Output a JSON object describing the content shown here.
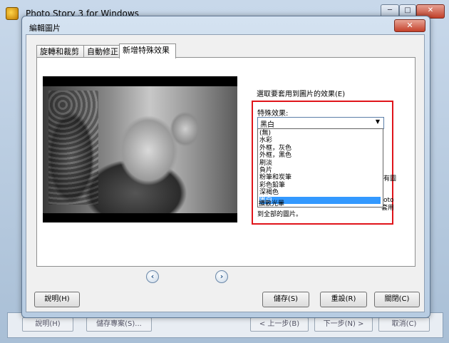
{
  "outer": {
    "title": "Photo Story 3 for Windows",
    "min_label": "─",
    "max_label": "□",
    "close_label": "✕",
    "ghost_buttons": [
      "說明(H)",
      "儲存專案(S)...",
      "< 上一步(B)",
      "下一步(N) >",
      "取消(C)"
    ]
  },
  "dialog": {
    "title": "編輯圖片",
    "close_label": "✕",
    "tabs": [
      "旋轉和裁剪",
      "自動修正",
      "新增特殊效果"
    ],
    "active_tab": 2
  },
  "nav": {
    "prev_label": "‹",
    "next_label": "›"
  },
  "effects": {
    "instruction": "選取要套用到圖片的效果(E)",
    "label": "特殊效果:",
    "selected": "黑白",
    "options": [
      "(無)",
      "水彩",
      "外框，灰色",
      "外框，黑色",
      "刷淡",
      "負片",
      "粉筆和炭筆",
      "彩色鉛筆",
      "深褐色",
      "黑白",
      "擴散光暈"
    ],
    "highlighted_index": 9,
    "peek_right_1": "有圖",
    "peek_right_2": "oto",
    "peek_line_a": "套用",
    "peek_line_b": "到全部的圖片。"
  },
  "buttons": {
    "help": "說明(H)",
    "save": "儲存(S)",
    "reset": "重設(R)",
    "close": "關閉(C)"
  },
  "colors": {
    "highlight_box": "#e0141a",
    "selection": "#3399ff"
  },
  "icons": {
    "app": "photo-story-icon",
    "prev": "chevron-left-icon",
    "next": "chevron-right-icon",
    "dropdown": "dropdown-arrow-icon"
  }
}
